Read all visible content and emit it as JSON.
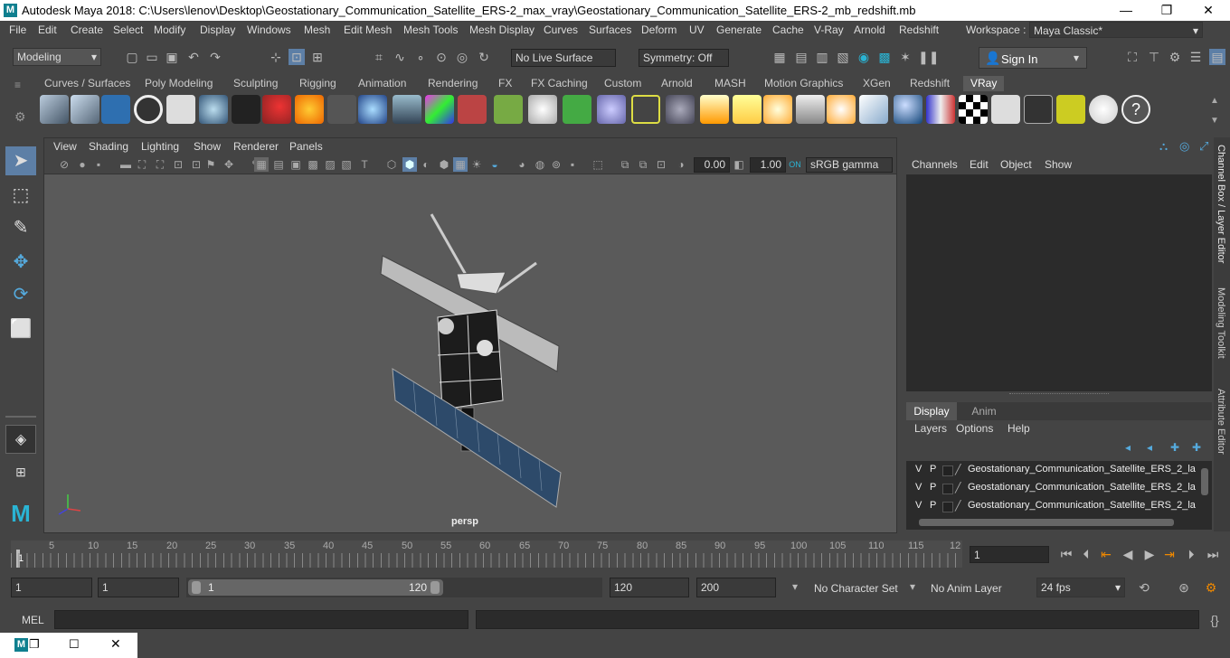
{
  "window": {
    "title": "Autodesk Maya 2018: C:\\Users\\lenov\\Desktop\\Geostationary_Communication_Satellite_ERS-2_max_vray\\Geostationary_Communication_Satellite_ERS-2_mb_redshift.mb",
    "minimize": "—",
    "maximize": "❐",
    "close": "✕"
  },
  "menu": [
    "File",
    "Edit",
    "Create",
    "Select",
    "Modify",
    "Display",
    "Windows",
    "Mesh",
    "Edit Mesh",
    "Mesh Tools",
    "Mesh Display",
    "Curves",
    "Surfaces",
    "Deform",
    "UV",
    "Generate",
    "Cache",
    "V-Ray",
    "Arnold",
    "Redshift"
  ],
  "workspace": {
    "label": "Workspace :",
    "value": "Maya Classic*"
  },
  "status": {
    "mode": "Modeling",
    "live_surface": "No Live Surface",
    "symmetry": "Symmetry: Off",
    "sign_in": "Sign In"
  },
  "shelf_tabs": [
    "Curves / Surfaces",
    "Poly Modeling",
    "Sculpting",
    "Rigging",
    "Animation",
    "Rendering",
    "FX",
    "FX Caching",
    "Custom",
    "Arnold",
    "MASH",
    "Motion Graphics",
    "XGen",
    "Redshift",
    "VRay"
  ],
  "active_shelf_tab": "VRay",
  "viewport": {
    "menu": [
      "View",
      "Shading",
      "Lighting",
      "Show",
      "Renderer",
      "Panels"
    ],
    "exposure": "0.00",
    "gamma": "1.00",
    "color_space": "sRGB gamma",
    "camera": "persp"
  },
  "channel_box": {
    "menu": [
      "Channels",
      "Edit",
      "Object",
      "Show"
    ]
  },
  "layer_editor": {
    "tabs": [
      "Display",
      "Anim"
    ],
    "menu": [
      "Layers",
      "Options",
      "Help"
    ],
    "rows": [
      {
        "v": "V",
        "p": "P",
        "name": "Geostationary_Communication_Satellite_ERS_2_la"
      },
      {
        "v": "V",
        "p": "P",
        "name": "Geostationary_Communication_Satellite_ERS_2_la"
      },
      {
        "v": "V",
        "p": "P",
        "name": "Geostationary_Communication_Satellite_ERS_2_la"
      }
    ]
  },
  "side_tabs": [
    "Channel Box / Layer Editor",
    "Modeling Toolkit",
    "Attribute Editor"
  ],
  "timeline": {
    "ticks": [
      "5",
      "10",
      "15",
      "20",
      "25",
      "30",
      "35",
      "40",
      "45",
      "50",
      "55",
      "60",
      "65",
      "70",
      "75",
      "80",
      "85",
      "90",
      "95",
      "100",
      "105",
      "110",
      "115",
      "12"
    ],
    "start_marker": "1",
    "current_frame": "1"
  },
  "range": {
    "start": "1",
    "playback_start": "1",
    "slider_start": "1",
    "slider_end": "120",
    "playback_end": "120",
    "end": "200",
    "character_set": "No Character Set",
    "anim_layer": "No Anim Layer",
    "fps": "24 fps"
  },
  "command_line": {
    "label": "MEL"
  }
}
